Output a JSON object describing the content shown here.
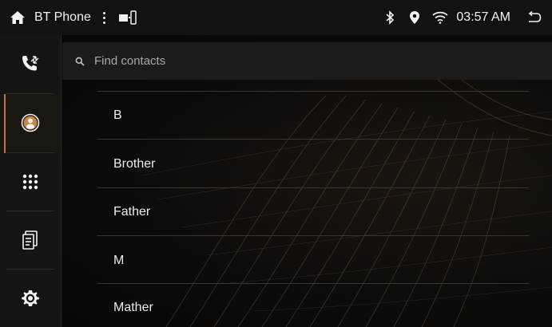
{
  "status_bar": {
    "app_title": "BT Phone",
    "time": "03:57 AM",
    "icons": [
      "home-icon",
      "more-vert-icon",
      "phone-link-icon",
      "bluetooth-icon",
      "location-icon",
      "wifi-icon",
      "back-icon"
    ]
  },
  "sidebar": {
    "items": [
      {
        "name": "call-log-icon",
        "active": false
      },
      {
        "name": "contacts-icon",
        "active": true
      },
      {
        "name": "dialpad-icon",
        "active": false
      },
      {
        "name": "phonebook-sync-icon",
        "active": false
      },
      {
        "name": "settings-icon",
        "active": false
      }
    ],
    "accent": "#b87938"
  },
  "search": {
    "placeholder": "Find contacts",
    "value": ""
  },
  "contacts": {
    "rows": [
      {
        "label": "B",
        "type": "header"
      },
      {
        "label": "Brother",
        "type": "contact"
      },
      {
        "label": "Father",
        "type": "contact"
      },
      {
        "label": "M",
        "type": "header"
      },
      {
        "label": "Mather",
        "type": "contact"
      }
    ]
  }
}
